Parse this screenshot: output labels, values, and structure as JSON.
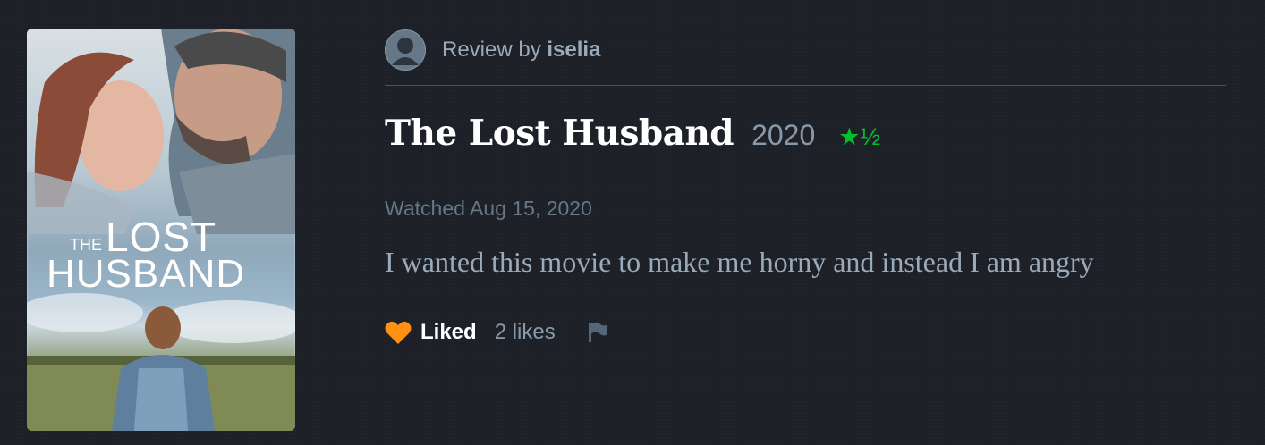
{
  "poster": {
    "title_the": "THE",
    "title_lost": "LOST",
    "title_husband": "HUSBAND"
  },
  "review": {
    "byline_prefix": "Review by ",
    "username": "iselia",
    "film_title": "The Lost Husband",
    "year": "2020",
    "rating_text": "★½",
    "rating_stars": 1.5,
    "watched": "Watched Aug 15, 2020",
    "body": "I wanted this movie to make me horny and instead I am angry",
    "liked_label": "Liked",
    "likes_count": "2 likes"
  },
  "colors": {
    "background": "#1d2127",
    "star_green": "#00c030",
    "heart_orange": "#ff9010",
    "text_muted": "#99aabb"
  },
  "icons": [
    "avatar-icon",
    "heart-icon",
    "flag-icon"
  ]
}
